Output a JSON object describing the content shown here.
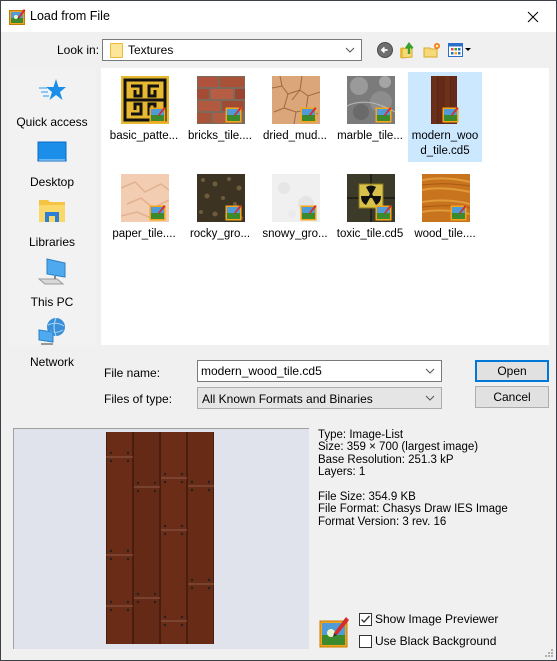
{
  "window": {
    "title": "Load from File",
    "icons": {
      "app": "paint-image-icon",
      "close": "close-icon"
    }
  },
  "toolbar": {
    "look_in_label": "Look in:",
    "look_in_value": "Textures",
    "buttons": [
      {
        "name": "back",
        "icon": "back-arrow-icon"
      },
      {
        "name": "up-folder",
        "icon": "up-folder-icon"
      },
      {
        "name": "new-folder",
        "icon": "new-folder-icon"
      },
      {
        "name": "view-menu",
        "icon": "view-menu-icon"
      }
    ]
  },
  "places": [
    {
      "label": "Quick access",
      "icon": "quick-access-star-icon"
    },
    {
      "label": "Desktop",
      "icon": "desktop-icon"
    },
    {
      "label": "Libraries",
      "icon": "libraries-icon"
    },
    {
      "label": "This PC",
      "icon": "this-pc-icon"
    },
    {
      "label": "Network",
      "icon": "network-icon"
    }
  ],
  "files": [
    {
      "name": "basic_patte...",
      "thumb": "greek-key-pattern",
      "selected": false
    },
    {
      "name": "bricks_tile....",
      "thumb": "bricks",
      "selected": false
    },
    {
      "name": "dried_mud...",
      "thumb": "dried-mud",
      "selected": false
    },
    {
      "name": "marble_tile...",
      "thumb": "marble",
      "selected": false
    },
    {
      "name": "modern_wood_tile.cd5",
      "thumb": "modern-wood",
      "selected": true
    },
    {
      "name": "paper_tile....",
      "thumb": "paper",
      "selected": false
    },
    {
      "name": "rocky_gro...",
      "thumb": "rocky-ground",
      "selected": false
    },
    {
      "name": "snowy_gro...",
      "thumb": "snowy-ground",
      "selected": false
    },
    {
      "name": "toxic_tile.cd5",
      "thumb": "toxic",
      "selected": false
    },
    {
      "name": "wood_tile....",
      "thumb": "wood",
      "selected": false
    }
  ],
  "form": {
    "file_name_label": "File name:",
    "file_name_value": "modern_wood_tile.cd5",
    "file_type_label": "Files of type:",
    "file_type_value": "All Known Formats and Binaries",
    "open_label": "Open",
    "cancel_label": "Cancel"
  },
  "info": {
    "type": "Type: Image-List",
    "size": "Size: 359 × 700  (largest image)",
    "resolution": "Base Resolution: 251.3 kP",
    "layers": "Layers: 1",
    "file_size": "File Size: 354.9 KB",
    "file_format": "File Format: Chasys Draw IES Image",
    "format_version": "Format Version: 3 rev. 16"
  },
  "options": {
    "show_previewer_label": "Show Image Previewer",
    "show_previewer_checked": true,
    "black_bg_label": "Use Black Background",
    "black_bg_checked": false
  },
  "colors": {
    "accent": "#0078d7",
    "selection": "#cce8ff",
    "preview_bg": "#e1e3ec"
  }
}
